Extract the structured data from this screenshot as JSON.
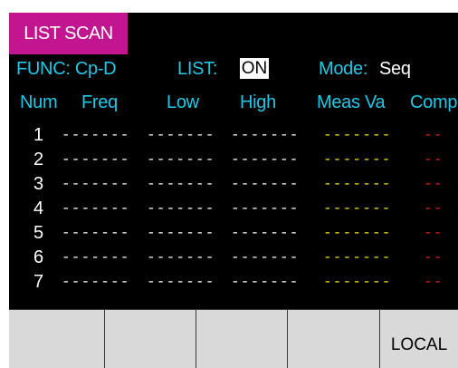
{
  "tab": {
    "label": "LIST SCAN"
  },
  "header": {
    "func_label": "FUNC: Cp-D",
    "list_label": "LIST:",
    "list_value": "ON",
    "mode_label": "Mode:",
    "mode_value": "Seq"
  },
  "columns": [
    "Num",
    "Freq",
    "Low",
    "High",
    "Meas Va",
    "Comp"
  ],
  "rows": [
    {
      "num": "1",
      "freq": "-------",
      "low": "-------",
      "high": "-------",
      "meas": "-------",
      "comp": "--"
    },
    {
      "num": "2",
      "freq": "-------",
      "low": "-------",
      "high": "-------",
      "meas": "-------",
      "comp": "--"
    },
    {
      "num": "3",
      "freq": "-------",
      "low": "-------",
      "high": "-------",
      "meas": "-------",
      "comp": "--"
    },
    {
      "num": "4",
      "freq": "-------",
      "low": "-------",
      "high": "-------",
      "meas": "-------",
      "comp": "--"
    },
    {
      "num": "5",
      "freq": "-------",
      "low": "-------",
      "high": "-------",
      "meas": "-------",
      "comp": "--"
    },
    {
      "num": "6",
      "freq": "-------",
      "low": "-------",
      "high": "-------",
      "meas": "-------",
      "comp": "--"
    },
    {
      "num": "7",
      "freq": "-------",
      "low": "-------",
      "high": "-------",
      "meas": "-------",
      "comp": "--"
    }
  ],
  "softkeys": [
    "",
    "",
    "",
    "",
    "LOCAL"
  ],
  "colors": {
    "tab": "#c21691",
    "label": "#22c7e8",
    "value": "#ffffff",
    "meas": "#f2e31c",
    "comp": "#e01f1f",
    "softkey": "#d9d9d9"
  }
}
